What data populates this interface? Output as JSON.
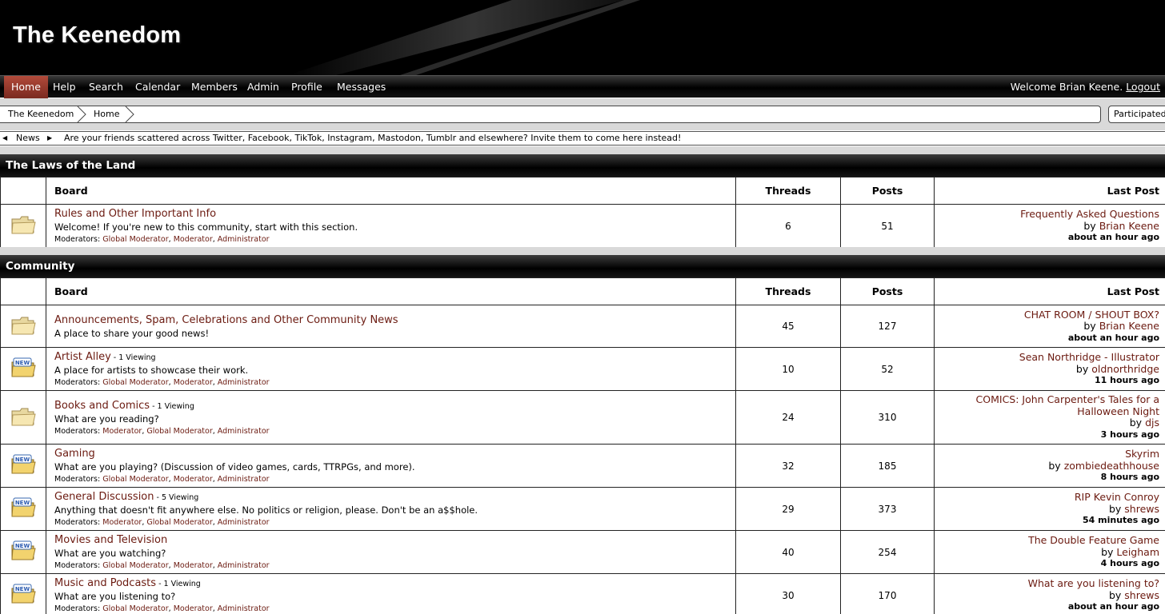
{
  "site": {
    "title": "The Keenedom"
  },
  "nav": {
    "items": [
      "Home",
      "Help",
      "Search",
      "Calendar",
      "Members",
      "Admin",
      "Profile",
      "Messages"
    ],
    "welcome_prefix": "Welcome Brian Keene.",
    "logout_label": "Logout"
  },
  "breadcrumb": {
    "items": [
      "The Keenedom",
      "Home"
    ]
  },
  "participated_label": "Participated",
  "news": {
    "label": "News",
    "text": "Are your friends scattered across Twitter, Facebook, TikTok, Instagram, Mastodon, Tumblr and elsewhere? Invite them to come here instead!"
  },
  "table_headers": {
    "board": "Board",
    "threads": "Threads",
    "posts": "Posts",
    "last_post": "Last Post"
  },
  "colors": {
    "accent_link": "#6b1a10",
    "active_nav": "#b24a3a",
    "background_gap": "#d9d9d9"
  },
  "categories": [
    {
      "name": "The Laws of the Land",
      "boards": [
        {
          "icon": "folder-icon",
          "title": "Rules and Other Important Info",
          "viewing": "",
          "description": "Welcome! If you're new to this community, start with this section.",
          "moderators_label": "Moderators:",
          "moderators": [
            "Global Moderator",
            "Moderator",
            "Administrator"
          ],
          "threads": "6",
          "posts": "51",
          "last_post": {
            "title": "Frequently Asked Questions",
            "by_prefix": "by",
            "by": "Brian Keene",
            "time": "about an hour ago"
          }
        }
      ]
    },
    {
      "name": "Community",
      "boards": [
        {
          "icon": "folder-icon",
          "title": "Announcements, Spam, Celebrations and Other Community News",
          "viewing": "",
          "description": "A place to share your good news!",
          "moderators_label": "",
          "moderators": [],
          "threads": "45",
          "posts": "127",
          "last_post": {
            "title": "CHAT ROOM / SHOUT BOX?",
            "by_prefix": "by",
            "by": "Brian Keene",
            "time": "about an hour ago"
          }
        },
        {
          "icon": "folder-new-icon",
          "title": "Artist Alley",
          "viewing": " - 1 Viewing",
          "description": "A place for artists to showcase their work.",
          "moderators_label": "Moderators:",
          "moderators": [
            "Global Moderator",
            "Moderator",
            "Administrator"
          ],
          "threads": "10",
          "posts": "52",
          "last_post": {
            "title": "Sean Northridge - Illustrator",
            "by_prefix": "by",
            "by": "oldnorthridge",
            "time": "11 hours ago"
          }
        },
        {
          "icon": "folder-icon",
          "title": "Books and Comics",
          "viewing": " - 1 Viewing",
          "description": "What are you reading?",
          "moderators_label": "Moderators:",
          "moderators": [
            "Moderator",
            "Global Moderator",
            "Administrator"
          ],
          "threads": "24",
          "posts": "310",
          "last_post": {
            "title": "COMICS: John Carpenter's Tales for a",
            "title_line2": "Halloween Night",
            "by_prefix": "by",
            "by": "djs",
            "time": "3 hours ago"
          }
        },
        {
          "icon": "folder-new-icon",
          "title": "Gaming",
          "viewing": "",
          "description": "What are you playing? (Discussion of video games, cards, TTRPGs, and more).",
          "moderators_label": "Moderators:",
          "moderators": [
            "Global Moderator",
            "Moderator",
            "Administrator"
          ],
          "threads": "32",
          "posts": "185",
          "last_post": {
            "title": "Skyrim",
            "by_prefix": "by",
            "by": "zombiedeathhouse",
            "time": "8 hours ago"
          }
        },
        {
          "icon": "folder-new-icon",
          "title": "General Discussion",
          "viewing": " - 5 Viewing",
          "description": "Anything that doesn't fit anywhere else. No politics or religion, please. Don't be an a$$hole.",
          "moderators_label": "Moderators:",
          "moderators": [
            "Moderator",
            "Global Moderator",
            "Administrator"
          ],
          "threads": "29",
          "posts": "373",
          "last_post": {
            "title": "RIP Kevin Conroy",
            "by_prefix": "by",
            "by": "shrews",
            "time": "54 minutes ago"
          }
        },
        {
          "icon": "folder-new-icon",
          "title": "Movies and Television",
          "viewing": "",
          "description": "What are you watching?",
          "moderators_label": "Moderators:",
          "moderators": [
            "Global Moderator",
            "Moderator",
            "Administrator"
          ],
          "threads": "40",
          "posts": "254",
          "last_post": {
            "title": "The Double Feature Game",
            "by_prefix": "by",
            "by": "Leigham",
            "time": "4 hours ago"
          }
        },
        {
          "icon": "folder-new-icon",
          "title": "Music and Podcasts",
          "viewing": " - 1 Viewing",
          "description": "What are you listening to?",
          "moderators_label": "Moderators:",
          "moderators": [
            "Global Moderator",
            "Moderator",
            "Administrator"
          ],
          "threads": "30",
          "posts": "170",
          "last_post": {
            "title": "What are you listening to?",
            "by_prefix": "by",
            "by": "shrews",
            "time": "about an hour ago"
          }
        }
      ]
    }
  ]
}
